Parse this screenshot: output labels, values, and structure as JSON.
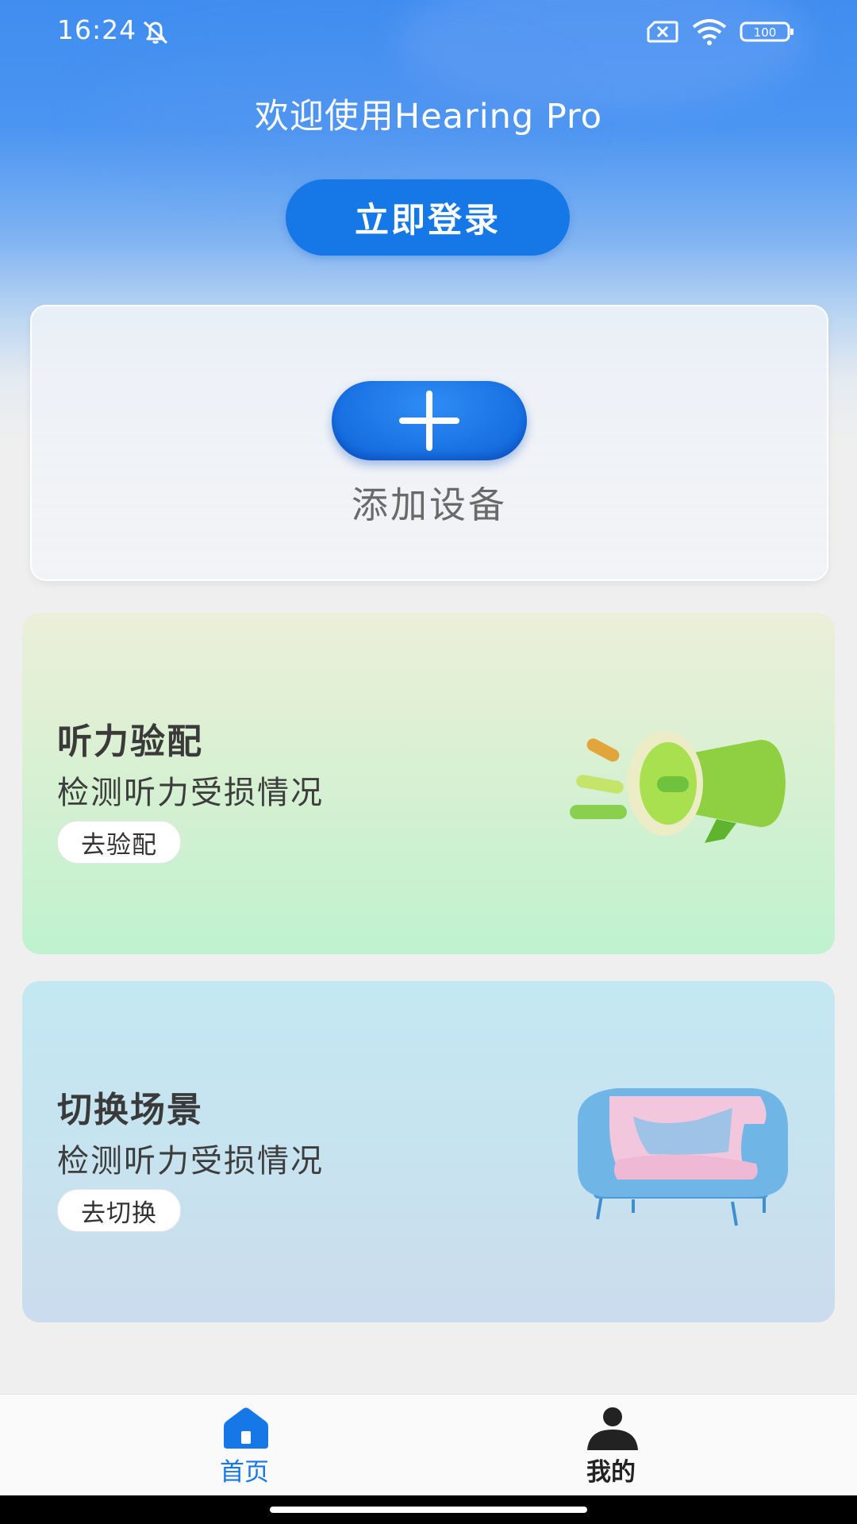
{
  "status_bar": {
    "time": "16:24",
    "battery": "100",
    "icons": [
      "mute-bell-icon",
      "no-sim-icon",
      "wifi-icon",
      "battery-icon"
    ]
  },
  "header": {
    "welcome": "欢迎使用Hearing Pro",
    "login_label": "立即登录"
  },
  "device": {
    "add_label": "添加设备",
    "icon": "plus-icon"
  },
  "cards": [
    {
      "title": "听力验配",
      "subtitle": "检测听力受损情况",
      "button": "去验配",
      "illustration": "megaphone-illustration"
    },
    {
      "title": "切换场景",
      "subtitle": "检测听力受损情况",
      "button": "去切换",
      "illustration": "sofa-illustration"
    }
  ],
  "tabbar": {
    "tabs": [
      {
        "label": "首页",
        "icon": "home-icon",
        "active": true
      },
      {
        "label": "我的",
        "icon": "person-icon",
        "active": false
      }
    ]
  },
  "colors": {
    "primary": "#1677e6",
    "header_blue": "#4b95f2"
  }
}
